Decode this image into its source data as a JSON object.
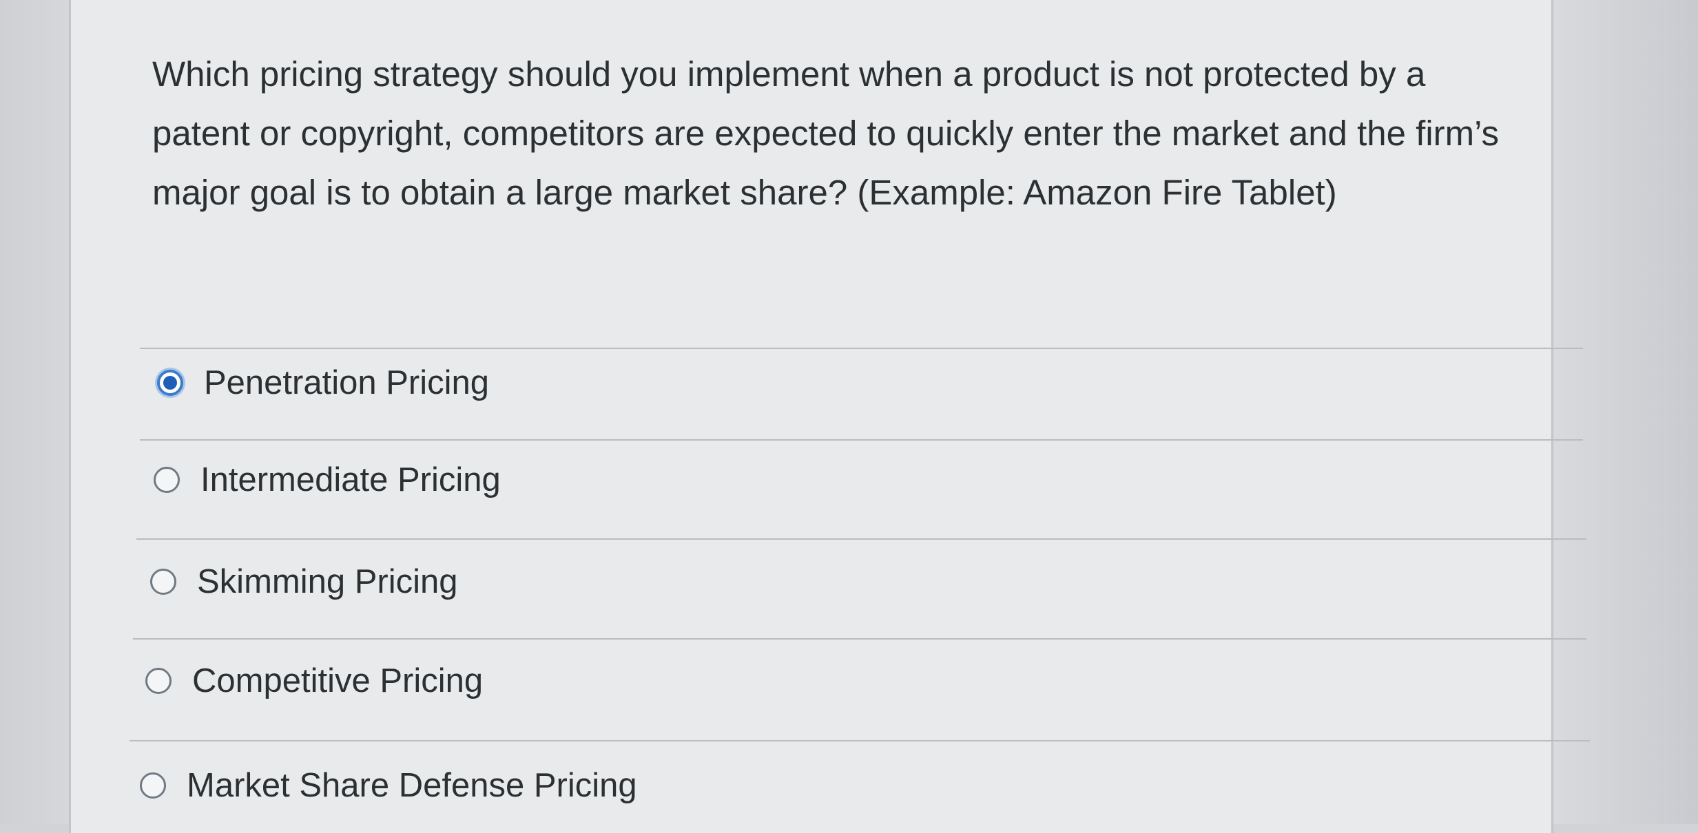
{
  "question": {
    "text": "Which pricing strategy should you implement when a product is not protected by a patent or copyright, competitors are expected to quickly enter the market and the firm’s major goal is to obtain a large market share? (Example: Amazon Fire Tablet)"
  },
  "answers": [
    {
      "label": "Penetration Pricing",
      "selected": true
    },
    {
      "label": "Intermediate Pricing",
      "selected": false
    },
    {
      "label": "Skimming Pricing",
      "selected": false
    },
    {
      "label": "Competitive Pricing",
      "selected": false
    },
    {
      "label": "Market Share Defense Pricing",
      "selected": false
    }
  ],
  "colors": {
    "selected_radio": "#1f5eb6",
    "card_background": "#e9eaec",
    "text": "#2b3033"
  }
}
